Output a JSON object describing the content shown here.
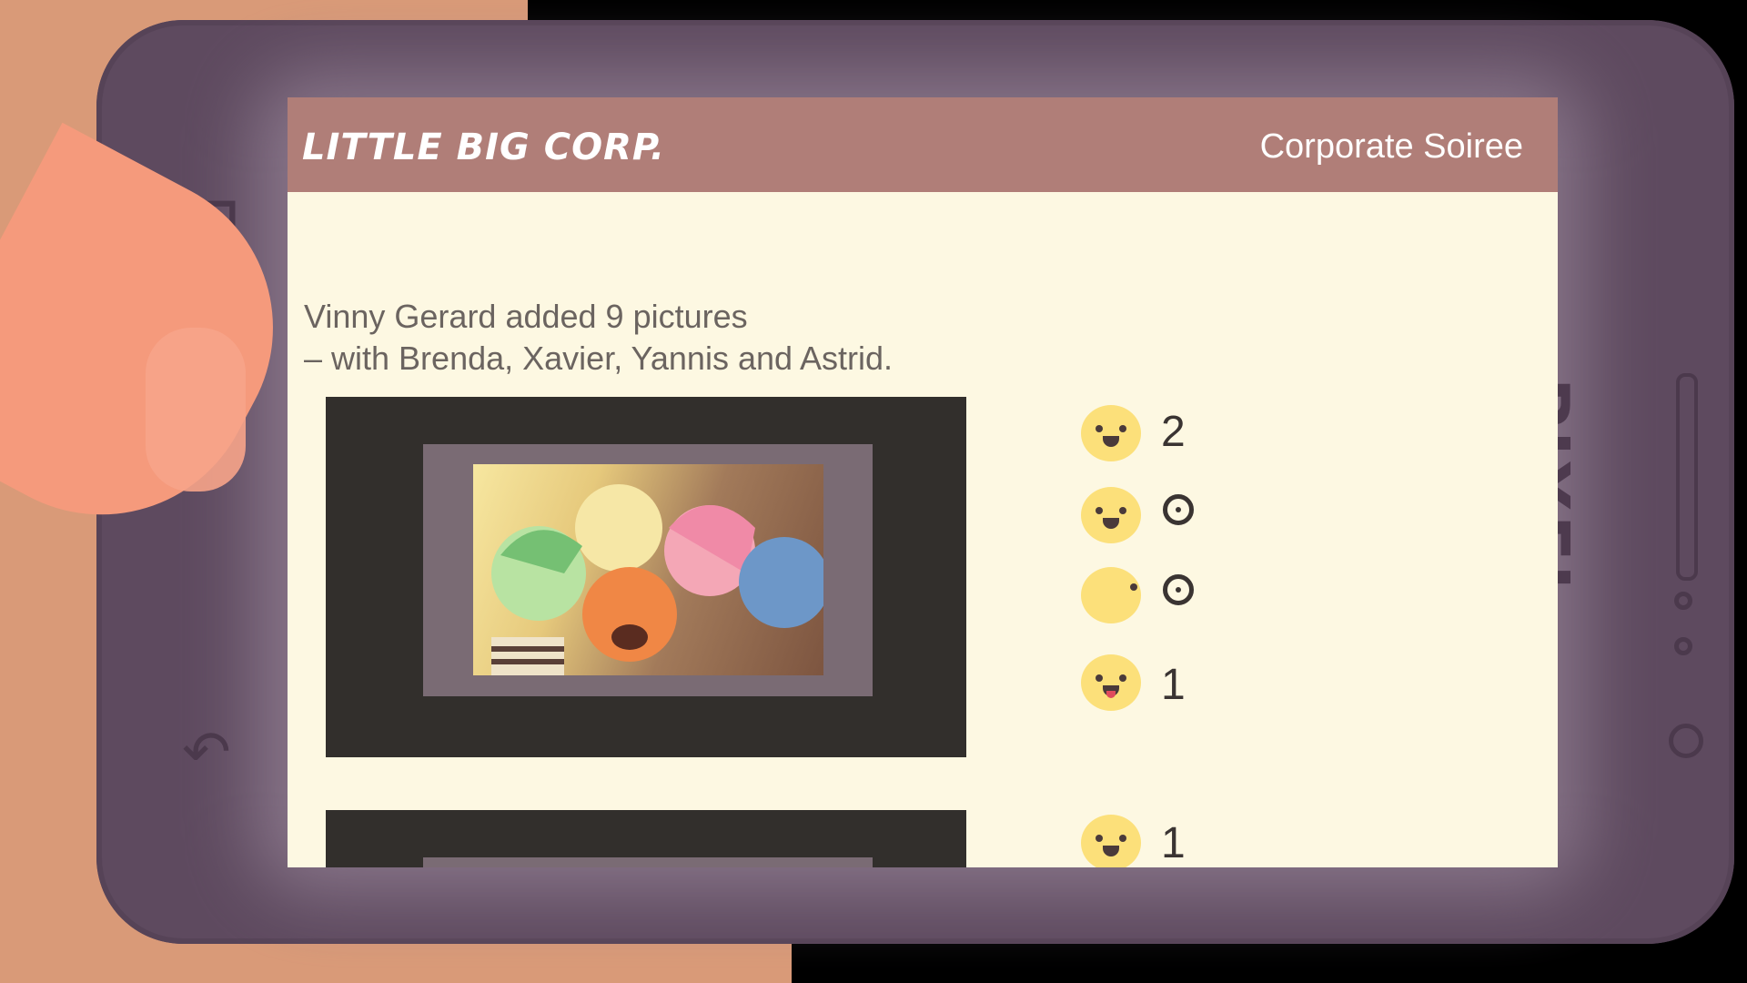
{
  "app": {
    "logo": "LITTLE BIG CORP.",
    "section_title": "Corporate Soiree"
  },
  "post": {
    "line1": "Vinny Gerard added 9 pictures",
    "line2": "– with Brenda, Xavier, Yannis and Astrid."
  },
  "reactions": [
    {
      "face": "happy-face-icon",
      "count": "2"
    },
    {
      "face": "happy-face-icon",
      "count": ""
    },
    {
      "face": "blank-face-icon",
      "count": ""
    },
    {
      "face": "tongue-face-icon",
      "count": "1"
    },
    {
      "face": "happy-face-icon",
      "count": "1"
    }
  ],
  "side_brand": "PIXEL",
  "colors": {
    "header": "#b07e78",
    "screen_bg": "#fdf8e2",
    "phone_body": "#5e4a5f",
    "reaction_face": "#fce07a"
  }
}
